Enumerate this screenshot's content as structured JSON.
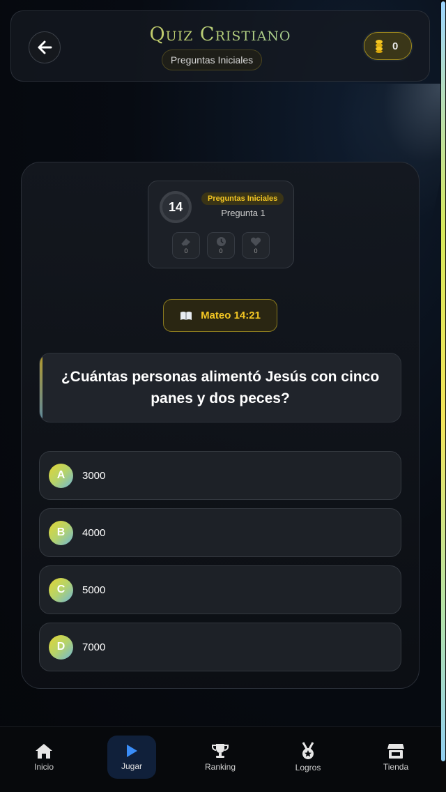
{
  "header": {
    "back_icon": "arrow-left-icon",
    "title": "Quiz Cristiano",
    "mode": "Preguntas Iniciales",
    "coins_icon": "coins-icon",
    "coins": "0"
  },
  "stats": {
    "timer": "14",
    "level": "Preguntas Iniciales",
    "question_number": "Pregunta 1",
    "powerups": [
      {
        "icon": "eraser-icon",
        "count": "0"
      },
      {
        "icon": "clock-icon",
        "count": "0"
      },
      {
        "icon": "heart-icon",
        "count": "0"
      }
    ]
  },
  "verse": {
    "icon": "book-icon",
    "reference": "Mateo 14:21"
  },
  "question": "¿Cuántas personas alimentó Jesús con cinco panes y dos peces?",
  "answers": [
    {
      "letter": "A",
      "text": "3000"
    },
    {
      "letter": "B",
      "text": "4000"
    },
    {
      "letter": "C",
      "text": "5000"
    },
    {
      "letter": "D",
      "text": "7000"
    }
  ],
  "nav": [
    {
      "label": "Inicio",
      "icon": "home-icon"
    },
    {
      "label": "Jugar",
      "icon": "play-icon",
      "active": true
    },
    {
      "label": "Ranking",
      "icon": "trophy-icon"
    },
    {
      "label": "Logros",
      "icon": "medal-icon"
    },
    {
      "label": "Tienda",
      "icon": "store-icon"
    }
  ],
  "colors": {
    "accent_gold": "#f3c623",
    "active_nav": "#10203a",
    "play_blue": "#3a8df7"
  }
}
